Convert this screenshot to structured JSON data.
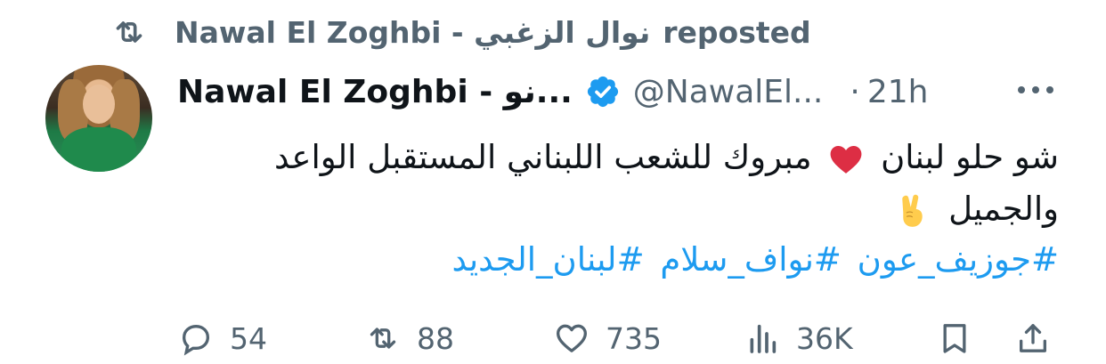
{
  "repost_bar": {
    "reposter_name": "Nawal El Zoghbi - نوال الزغبي",
    "action_text": "reposted"
  },
  "tweet": {
    "author": {
      "display_name": "Nawal El Zoghbi - نو...",
      "handle": "@NawalEl...",
      "verified": true,
      "verified_color": "#1d9bf0"
    },
    "dot": "·",
    "time": "21h",
    "text_line_1": "شو حلو لبنان ❤️ مبروك للشعب اللبناني المستقبل الواعد",
    "text_line_1_parts": [
      "شو حلو لبنان",
      "مبروك للشعب اللبناني المستقبل الواعد"
    ],
    "text_line_2": "والجميل ✌️",
    "text_line_2_word": "والجميل",
    "hashtags": [
      "#جوزيف_عون",
      "#نواف_سلام",
      "#لبنان_الجديد"
    ],
    "hashtag_color": "#1d9bf0"
  },
  "actions": {
    "replies": "54",
    "reposts": "88",
    "likes": "735",
    "views": "36K",
    "icons": [
      "reply-icon",
      "repost-icon",
      "like-icon",
      "views-icon",
      "bookmark-icon",
      "share-icon"
    ]
  },
  "colors": {
    "text": "#0f1419",
    "secondary": "#536471",
    "heart": "#e0245e"
  }
}
